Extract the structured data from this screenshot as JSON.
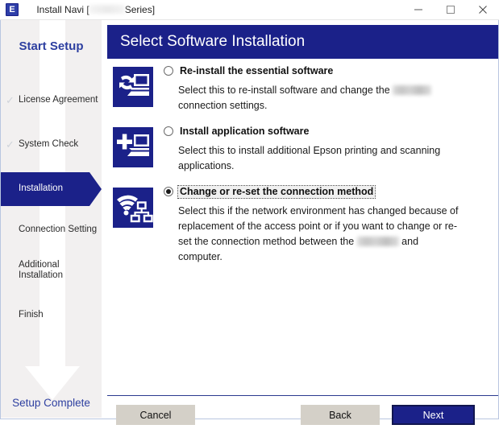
{
  "window": {
    "title_prefix": "Install Navi [",
    "title_suffix": "Series]",
    "app_icon": "epson-e-icon",
    "minimize_label": "Minimize",
    "maximize_label": "Maximize",
    "close_label": "Close"
  },
  "sidebar": {
    "top_label": "Start Setup",
    "bottom_label": "Setup Complete",
    "steps": [
      {
        "label": "License Agreement",
        "state": "done",
        "check": "✓"
      },
      {
        "label": "System Check",
        "state": "done",
        "check": "✓"
      },
      {
        "label": "Installation",
        "state": "active"
      },
      {
        "label": "Connection Setting",
        "state": "pending"
      },
      {
        "label": "Additional\nInstallation",
        "state": "pending"
      },
      {
        "label": "Finish",
        "state": "pending"
      }
    ]
  },
  "header": {
    "title": "Select Software Installation"
  },
  "options": [
    {
      "icon": "reinstall-software-icon",
      "title": "Re-install the essential software",
      "selected": false,
      "focused": false,
      "desc_part1": "Select this to re-install software and change the ",
      "desc_part2": " connection settings.",
      "redacted": true
    },
    {
      "icon": "install-application-icon",
      "title": "Install application software",
      "selected": false,
      "focused": false,
      "desc_part1": "Select this to install additional Epson printing and scanning applications.",
      "desc_part2": "",
      "redacted": false
    },
    {
      "icon": "network-connection-icon",
      "title": "Change or re-set the connection method",
      "selected": true,
      "focused": true,
      "desc_part1": "Select this if the network environment has changed because of replacement of the access point or if you want to change or re-set the connection method between the ",
      "desc_part2": " and computer.",
      "redacted": true
    }
  ],
  "footer": {
    "cancel_label": "Cancel",
    "back_label": "Back",
    "next_label": "Next"
  },
  "colors": {
    "brand_blue": "#1b2189",
    "sidebar_bg": "#f2f0f0",
    "button_face": "#d4d0c8",
    "link_blue": "#2d3fa0"
  }
}
